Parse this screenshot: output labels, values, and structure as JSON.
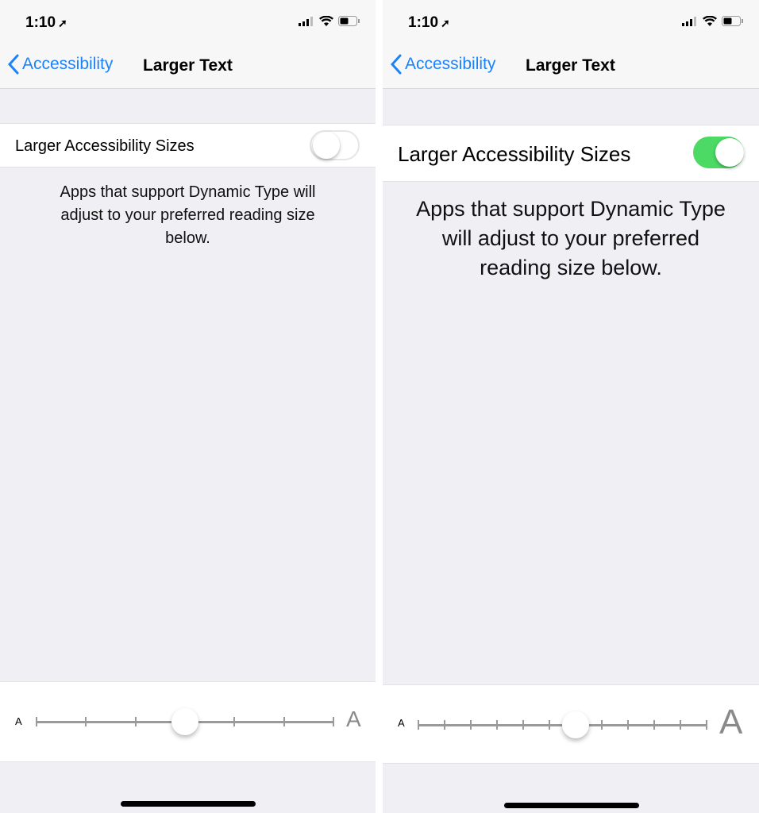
{
  "panels": [
    {
      "time": "1:10",
      "back_label": "Accessibility",
      "title": "Larger Text",
      "toggle_label": "Larger Accessibility Sizes",
      "toggle_on": false,
      "description": "Apps that support Dynamic Type will adjust to your preferred reading size below.",
      "slider": {
        "small_label": "A",
        "large_label": "A",
        "positions": 7,
        "value_index": 3
      }
    },
    {
      "time": "1:10",
      "back_label": "Accessibility",
      "title": "Larger Text",
      "toggle_label": "Larger Accessibility Sizes",
      "toggle_on": true,
      "description": "Apps that support Dynamic Type will adjust to your preferred reading size below.",
      "slider": {
        "small_label": "A",
        "large_label": "A",
        "positions": 12,
        "value_index": 6
      }
    }
  ],
  "colors": {
    "accent": "#1a82fb",
    "toggle_on": "#4cd964",
    "background": "#efeff4"
  },
  "icons": [
    "location-arrow-icon",
    "cellular-signal-icon",
    "wifi-icon",
    "battery-icon",
    "chevron-left-icon"
  ]
}
